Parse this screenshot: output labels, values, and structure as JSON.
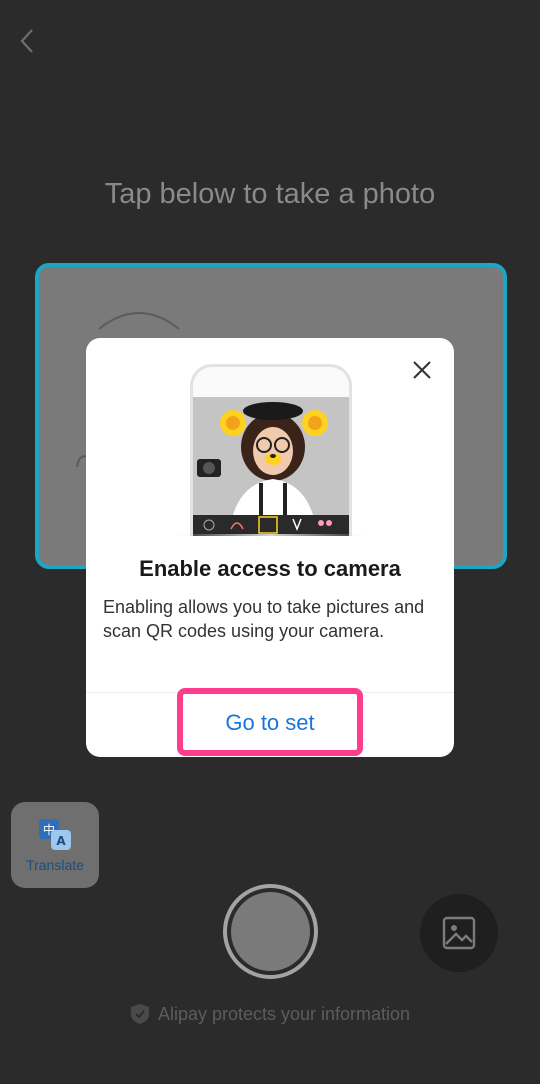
{
  "header": {
    "back_icon": "chevron-left-icon"
  },
  "camera": {
    "hint": "Tap below to take a photo",
    "accent_color": "#1aa7c3"
  },
  "translate": {
    "label": "Translate",
    "icon": "translate-icon"
  },
  "footer": {
    "text": "Alipay protects your information",
    "icon": "shield-icon"
  },
  "dialog": {
    "title": "Enable access to camera",
    "body": "Enabling allows you to take pictures and scan QR codes using your camera.",
    "action_label": "Go to set",
    "close_icon": "close-icon",
    "action_color": "#1677d8",
    "highlight_color": "#ff3d8d"
  }
}
